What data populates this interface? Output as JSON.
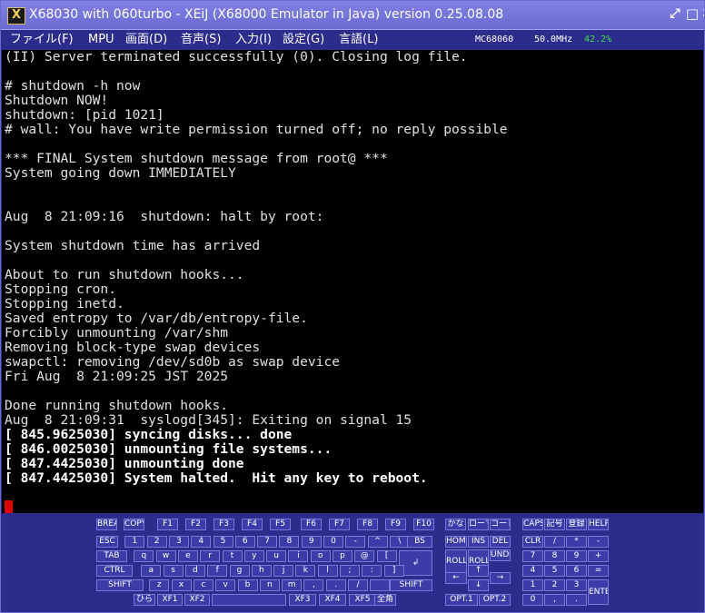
{
  "window": {
    "title": "X68030 with 060turbo - XEiJ (X68000 Emulator in Java) version 0.25.08.08",
    "icon_glyph": "X",
    "buttons": {
      "restore": "⤢",
      "maximize": "□",
      "close": "✕"
    }
  },
  "menubar": {
    "items": [
      "ファイル(F)",
      "MPU",
      "画面(D)",
      "音声(S)",
      "入力(I)",
      "設定(G)",
      "言語(L)"
    ],
    "cpu": "MC68060",
    "clock": "50.0MHz",
    "load": "42.2%"
  },
  "colors": {
    "background": "#2c2c8c",
    "load": "#40e040",
    "cursor": "#e00000"
  },
  "terminal": {
    "lines": [
      "(II) Server terminated successfully (0). Closing log file.",
      "",
      "# shutdown -h now",
      "Shutdown NOW!",
      "shutdown: [pid 1021]",
      "# wall: You have write permission turned off; no reply possible",
      "",
      "*** FINAL System shutdown message from root@ ***",
      "System going down IMMEDIATELY",
      "",
      "",
      "Aug  8 21:09:16  shutdown: halt by root:",
      "",
      "System shutdown time has arrived",
      "",
      "About to run shutdown hooks...",
      "Stopping cron.",
      "Stopping inetd.",
      "Saved entropy to /var/db/entropy-file.",
      "Forcibly unmounting /var/shm",
      "Removing block-type swap devices",
      "swapctl: removing /dev/sd0b as swap device",
      "Fri Aug  8 21:09:25 JST 2025",
      "",
      "Done running shutdown hooks.",
      "Aug  8 21:09:31  syslogd[345]: Exiting on signal 15",
      "[ 845.9625030] syncing disks... done",
      "[ 846.0025030] unmounting file systems...",
      "[ 847.4425030] unmounting done",
      "[ 847.4425030] System halted.  Hit any key to reboot."
    ]
  },
  "keyboard": {
    "fn_row": [
      "BREAK",
      "COPY",
      "F1",
      "F2",
      "F3",
      "F4",
      "F5",
      "F6",
      "F7",
      "F8",
      "F9",
      "F10",
      "かな",
      "ローマ",
      "コード",
      "CAPS",
      "記号",
      "登録",
      "HELP"
    ],
    "row1": [
      "ESC",
      "1",
      "2",
      "3",
      "4",
      "5",
      "6",
      "7",
      "8",
      "9",
      "0",
      "-",
      "^",
      "\\",
      "BS"
    ],
    "row2": [
      "TAB",
      "q",
      "w",
      "e",
      "r",
      "t",
      "y",
      "u",
      "i",
      "o",
      "p",
      "@",
      "["
    ],
    "row3": [
      "CTRL",
      "a",
      "s",
      "d",
      "f",
      "g",
      "h",
      "j",
      "k",
      "l",
      ";",
      ":",
      "]"
    ],
    "row4": [
      "SHIFT",
      "z",
      "x",
      "c",
      "v",
      "b",
      "n",
      "m",
      ",",
      ".",
      "/",
      "",
      "SHIFT"
    ],
    "row5": [
      "ひら",
      "XF1",
      "XF2",
      "",
      "XF3",
      "XF4",
      "XF5",
      "全角"
    ],
    "return_key": "↲",
    "edit": [
      "HOME",
      "INS",
      "DEL",
      "ROLL UP",
      "ROLL DOWN",
      "UNDO"
    ],
    "arrows": [
      "↑",
      "←",
      "→",
      "↓"
    ],
    "opt": [
      "OPT.1",
      "OPT.2"
    ],
    "numpad": [
      "CLR",
      "/",
      "*",
      "-",
      "7",
      "8",
      "9",
      "+",
      "4",
      "5",
      "6",
      "=",
      "1",
      "2",
      "3",
      "0",
      ",",
      ".",
      "ENTER"
    ]
  }
}
